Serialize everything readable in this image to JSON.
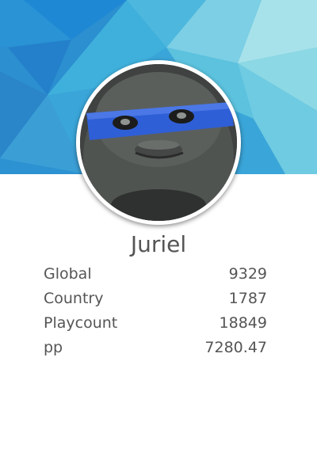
{
  "profile": {
    "username": "Juriel",
    "avatar_description": "avatar",
    "stats": [
      {
        "label": "Global",
        "value": "9329"
      },
      {
        "label": "Country",
        "value": "1787"
      },
      {
        "label": "Playcount",
        "value": "18849"
      },
      {
        "label": "pp",
        "value": "7280.47"
      }
    ]
  },
  "colors": {
    "banner_base": "#2fa3d6",
    "banner_light": "#8fd6e8",
    "banner_dark": "#1d7fc4",
    "text": "#555555",
    "avatar_ring": "#ffffff",
    "mask_blue": "#2f5fd6"
  }
}
